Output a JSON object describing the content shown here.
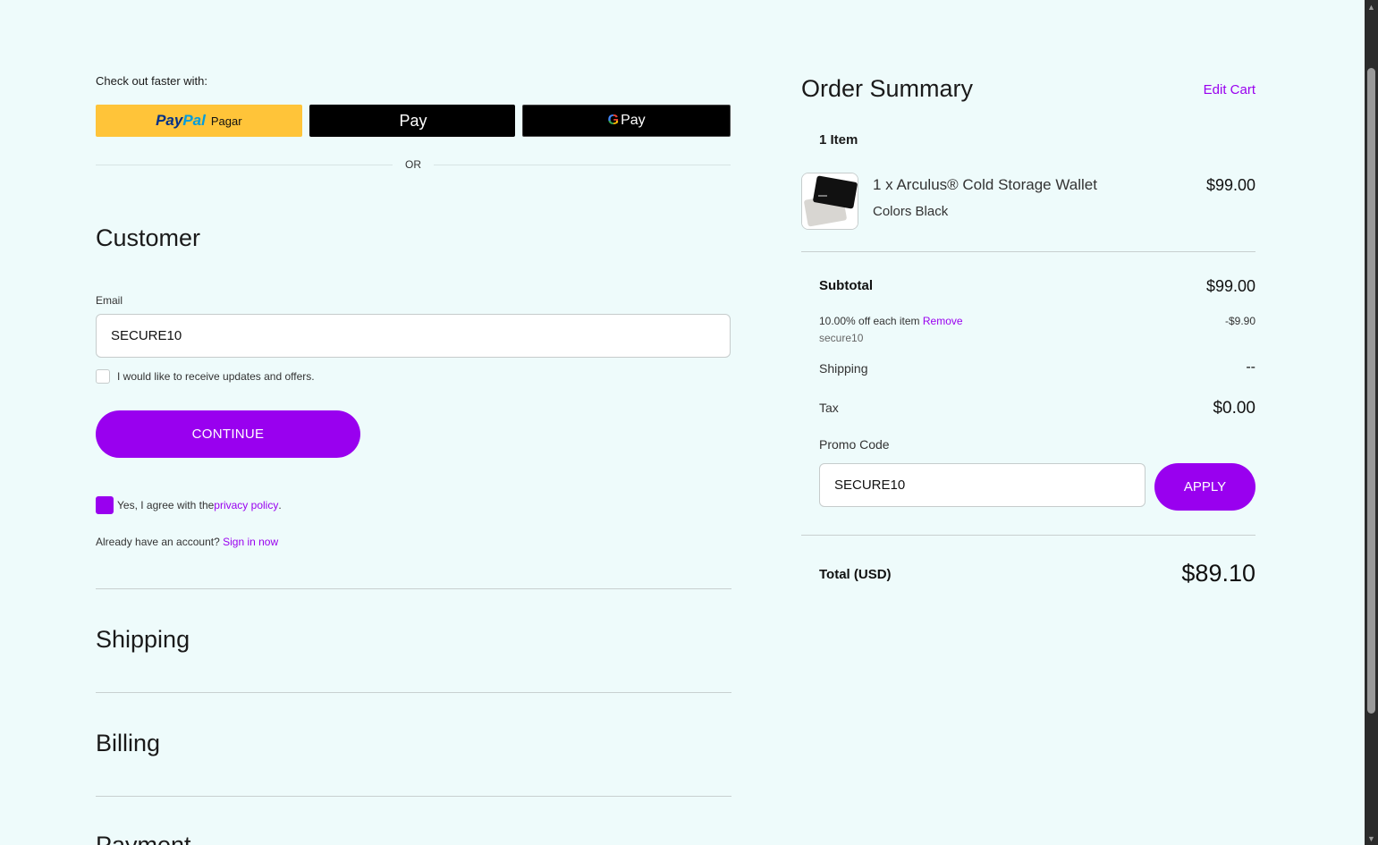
{
  "checkout": {
    "faster_label": "Check out faster with:",
    "paypal_word1": "Pay",
    "paypal_word2": "Pal",
    "paypal_suffix": "Pagar",
    "apple_glyph": "",
    "applepay_label": "Pay",
    "gpay_g": "G",
    "gpay_label": "Pay",
    "or_label": "OR"
  },
  "customer": {
    "title": "Customer",
    "email_label": "Email",
    "email_value": "SECURE10",
    "updates_label": "I would like to receive updates and offers.",
    "continue_label": "CONTINUE",
    "privacy_prefix": "Yes, I agree with the ",
    "privacy_link": "privacy policy",
    "privacy_suffix": ".",
    "account_prefix": "Already have an account? ",
    "sign_in_link": "Sign in now"
  },
  "sections": {
    "shipping": "Shipping",
    "billing": "Billing",
    "payment": "Payment"
  },
  "summary": {
    "title": "Order Summary",
    "edit_cart": "Edit Cart",
    "items_count": "1 Item",
    "item_name": "1 x Arculus® Cold Storage Wallet",
    "item_options": "Colors Black",
    "item_price": "$99.00",
    "subtotal_label": "Subtotal",
    "subtotal_value": "$99.00",
    "discount_label": "10.00% off each item ",
    "discount_remove": "Remove",
    "discount_code": "secure10",
    "discount_value": "-$9.90",
    "shipping_label": "Shipping",
    "shipping_value": "--",
    "tax_label": "Tax",
    "tax_value": "$0.00",
    "promo_label": "Promo Code",
    "promo_value": "SECURE10",
    "apply_label": "APPLY",
    "total_label": "Total (USD)",
    "total_value": "$89.10"
  },
  "colors": {
    "accent": "#9900ef",
    "background": "#eefbfb",
    "paypal_yellow": "#ffc439"
  }
}
